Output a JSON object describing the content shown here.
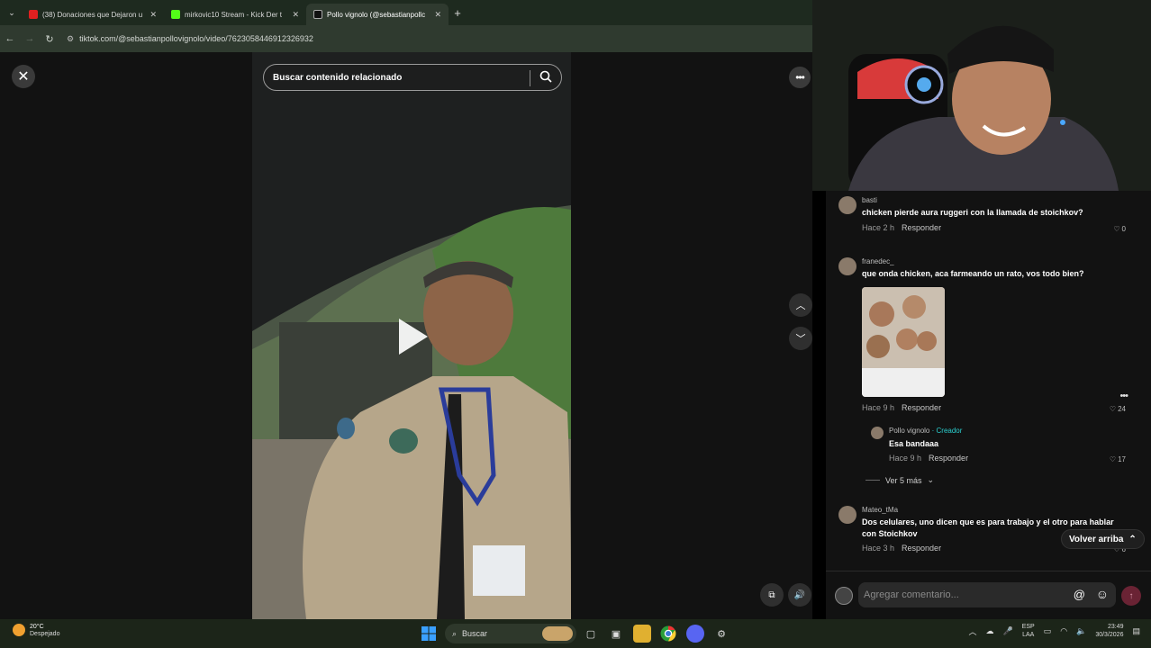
{
  "browser": {
    "tabs": [
      {
        "label": "(38) Donaciones que Dejaron u",
        "favicon_color": "#e02020",
        "icon": "youtube-icon",
        "active": false
      },
      {
        "label": "mirkovic10 Stream - Kick Der t",
        "favicon_color": "#53fc18",
        "icon": "kick-icon",
        "active": false
      },
      {
        "label": "Pollo vignolo (@sebastianpollc",
        "favicon_color": "#ffffff",
        "icon": "tiktok-icon",
        "active": true
      }
    ],
    "url": "tiktok.com/@sebastianpollovignolo/video/7623058446912326932"
  },
  "video": {
    "search_placeholder": "Buscar contenido relacionado"
  },
  "comments": [
    {
      "user": "basti",
      "text": "chicken pierde aura ruggeri con la llamada de stoichkov?",
      "time": "Hace 2 h",
      "reply": "Responder",
      "likes": "0"
    },
    {
      "user": "franedec_",
      "text": "que onda chicken, aca farmeando un rato, vos todo bien?",
      "time": "Hace 9 h",
      "reply": "Responder",
      "likes": "24"
    },
    {
      "user": "Pollo vignolo",
      "creator": "· Creador",
      "text": "Esa bandaaa",
      "time": "Hace 9 h",
      "reply": "Responder",
      "likes": "17"
    },
    {
      "user": "Mateo_tMa",
      "text": "Dos celulares, uno dicen que es para trabajo y el otro para hablar con Stoichkov",
      "time": "Hace 3 h",
      "reply": "Responder",
      "likes": "6"
    }
  ],
  "ver_mas": "Ver 5 más",
  "volver_arriba": "Volver arriba",
  "add_comment_placeholder": "Agregar comentario...",
  "taskbar": {
    "temp": "20°C",
    "condition": "Despejado",
    "search": "Buscar",
    "lang": "ESP",
    "layout": "LAA",
    "time": "23:49",
    "date": "30/3/2026"
  }
}
